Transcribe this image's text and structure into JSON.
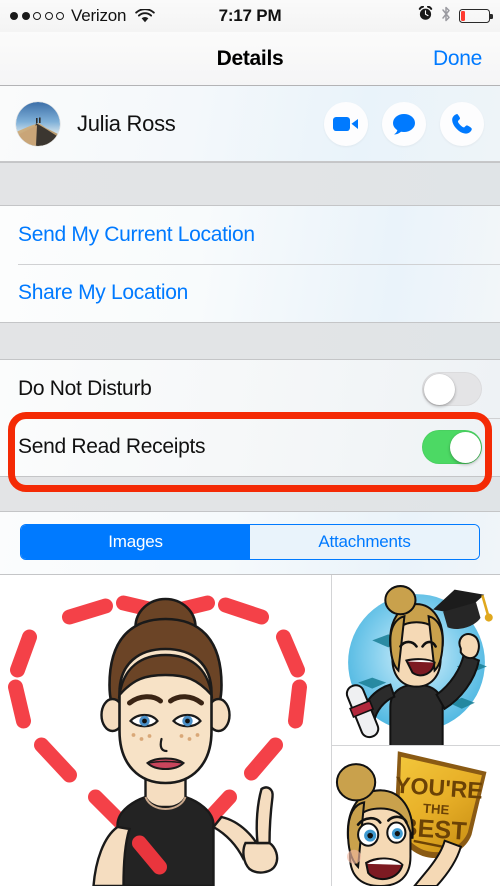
{
  "status_bar": {
    "signal_dots_filled": 2,
    "signal_dots_total": 5,
    "carrier": "Verizon",
    "wifi_icon": "wifi-icon",
    "time": "7:17 PM",
    "alarm_icon": "alarm-clock-icon",
    "bluetooth_icon": "bluetooth-icon",
    "battery_icon": "battery-low-icon",
    "battery_percent": 12,
    "battery_color": "#ff3b30"
  },
  "nav": {
    "title": "Details",
    "done_label": "Done"
  },
  "contact": {
    "name": "Julia Ross",
    "avatar_name": "avatar",
    "actions": [
      {
        "name": "facetime-video-button",
        "icon": "video-camera-icon"
      },
      {
        "name": "message-button",
        "icon": "speech-bubble-icon"
      },
      {
        "name": "call-button",
        "icon": "phone-icon"
      }
    ],
    "accent_color": "#007aff"
  },
  "location_section": {
    "items": [
      {
        "label": "Send My Current Location",
        "name": "send-my-current-location-row"
      },
      {
        "label": "Share My Location",
        "name": "share-my-location-row"
      }
    ],
    "link_color": "#007aff"
  },
  "toggle_section": {
    "items": [
      {
        "label": "Do Not Disturb",
        "name": "do-not-disturb-row",
        "value": "off"
      },
      {
        "label": "Send Read Receipts",
        "name": "send-read-receipts-row",
        "value": "on"
      }
    ],
    "on_color": "#4cd964",
    "off_color": "#e4e4e6"
  },
  "annotation": {
    "name": "highlight-box",
    "target": "Send Read Receipts",
    "color": "#f42a05"
  },
  "segmented_control": {
    "options": [
      {
        "label": "Images",
        "selected": true
      },
      {
        "label": "Attachments",
        "selected": false
      }
    ],
    "selected_color": "#007aff",
    "unselected_bg": "#e9f3fb"
  },
  "attachments_grid": {
    "items": [
      {
        "name": "thumbnail-heart-bitmoji",
        "description": "Bitmoji drawing a red dashed heart with finger"
      },
      {
        "name": "thumbnail-graduation-bitmoji",
        "description": "Bitmoji graduate tossing cap holding diploma"
      },
      {
        "name": "thumbnail-youre-the-best-bitmoji",
        "description": "Bitmoji holding gold shield",
        "shield_text_line1": "YOU'RE",
        "shield_text_line2": "THE",
        "shield_text_line3": "BEST"
      }
    ]
  }
}
